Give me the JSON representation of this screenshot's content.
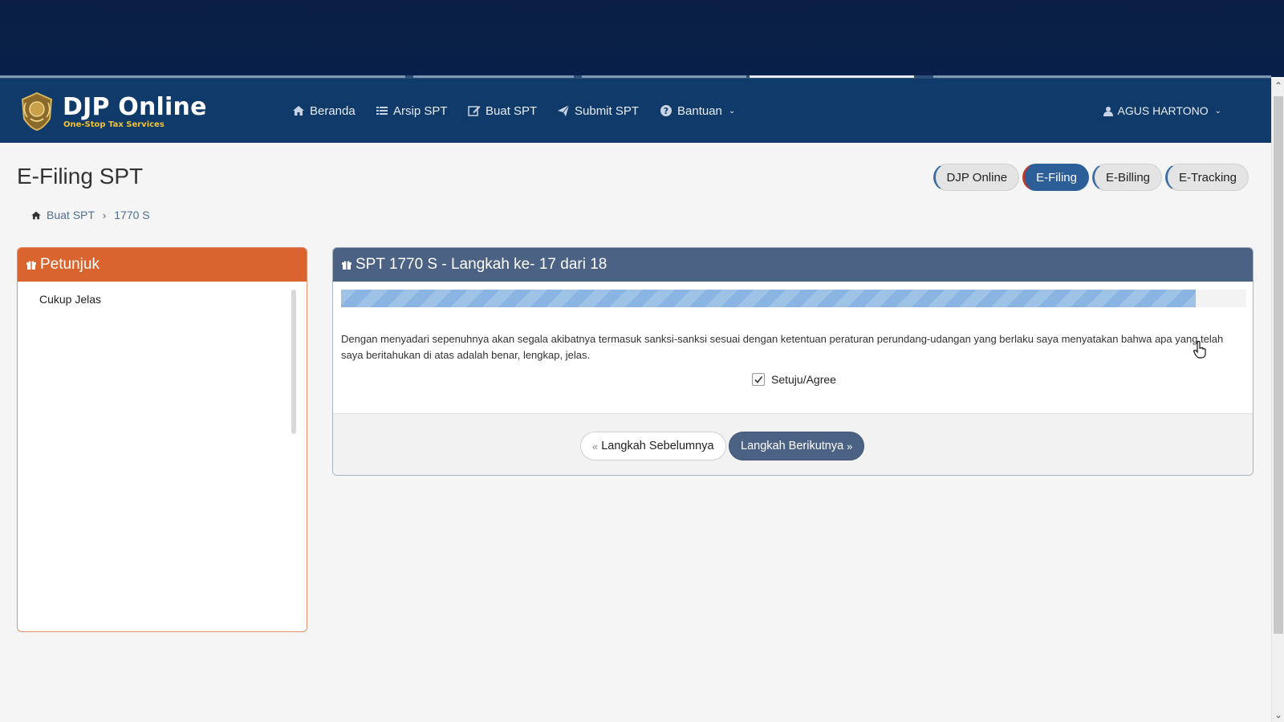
{
  "brand": {
    "title": "DJP Online",
    "subtitle": "One-Stop Tax Services"
  },
  "nav": {
    "items": [
      {
        "label": "Beranda",
        "icon": "home-icon"
      },
      {
        "label": "Arsip SPT",
        "icon": "list-icon"
      },
      {
        "label": "Buat SPT",
        "icon": "edit-icon"
      },
      {
        "label": "Submit SPT",
        "icon": "send-icon"
      },
      {
        "label": "Bantuan",
        "icon": "question-circle-icon"
      }
    ],
    "user": "AGUS HARTONO"
  },
  "page": {
    "title": "E-Filing SPT"
  },
  "breadcrumb": {
    "items": [
      "Buat SPT",
      "1770 S"
    ]
  },
  "services": {
    "items": [
      "DJP Online",
      "E-Filing",
      "E-Billing",
      "E-Tracking"
    ],
    "active": "E-Filing"
  },
  "petunjuk": {
    "title": "Petunjuk",
    "content": "Cukup Jelas"
  },
  "spt": {
    "title": "SPT 1770 S - Langkah ke- 17 dari 18",
    "progress_percent": 94.4,
    "statement": "Dengan menyadari sepenuhnya akan segala akibatnya termasuk sanksi-sanksi sesuai dengan ketentuan peraturan perundang-udangan yang berlaku saya menyatakan bahwa apa yang telah saya beritahukan di atas adalah benar, lengkap, jelas.",
    "agree_label": "Setuju/Agree",
    "agree_checked": true,
    "prev_label": "Langkah Sebelumnya",
    "next_label": "Langkah Berikutnya"
  },
  "colors": {
    "navbar": "#0f3a6a",
    "petunjuk_header": "#d9642f",
    "panel_header": "#4c6284",
    "progress_fill": "#8ab4e2",
    "active_pill": "#2c5f97"
  }
}
